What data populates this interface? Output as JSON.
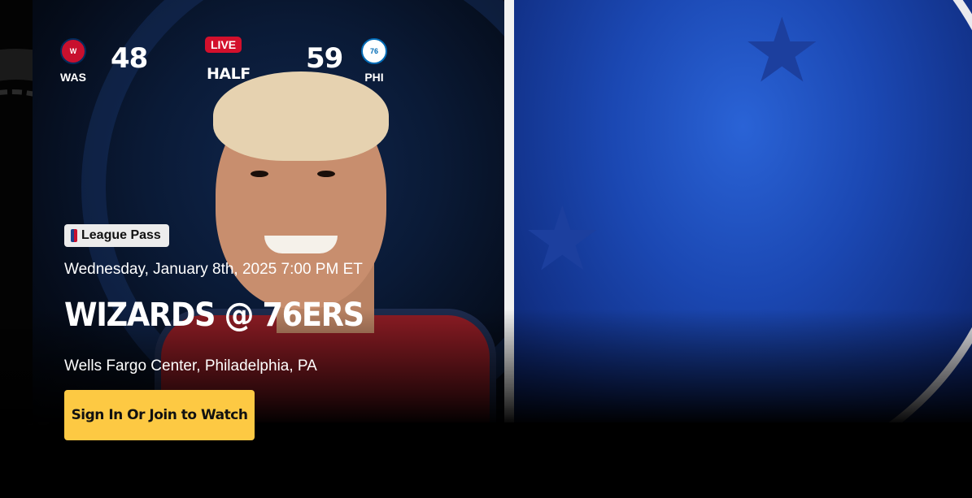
{
  "game": {
    "away": {
      "abbr": "WAS",
      "score": "48",
      "logo": "wizards-logo-icon",
      "color": "#c8102e"
    },
    "home": {
      "abbr": "PHI",
      "score": "59",
      "logo": "76ers-logo-icon",
      "color": "#006bb6"
    },
    "status": {
      "live_label": "LIVE",
      "period": "HALF"
    }
  },
  "event": {
    "badge": "League Pass",
    "badge_icon": "nba-logo-icon",
    "datetime": "Wednesday, January 8th, 2025 7:00 PM ET",
    "matchup": "WIZARDS @ 76ERS",
    "venue": "Wells Fargo Center, Philadelphia, PA"
  },
  "cta": {
    "label": "Sign In Or Join to Watch",
    "color": "#fdc943"
  },
  "colors": {
    "live": "#d3102c",
    "right_panel": "#1b48b3"
  }
}
